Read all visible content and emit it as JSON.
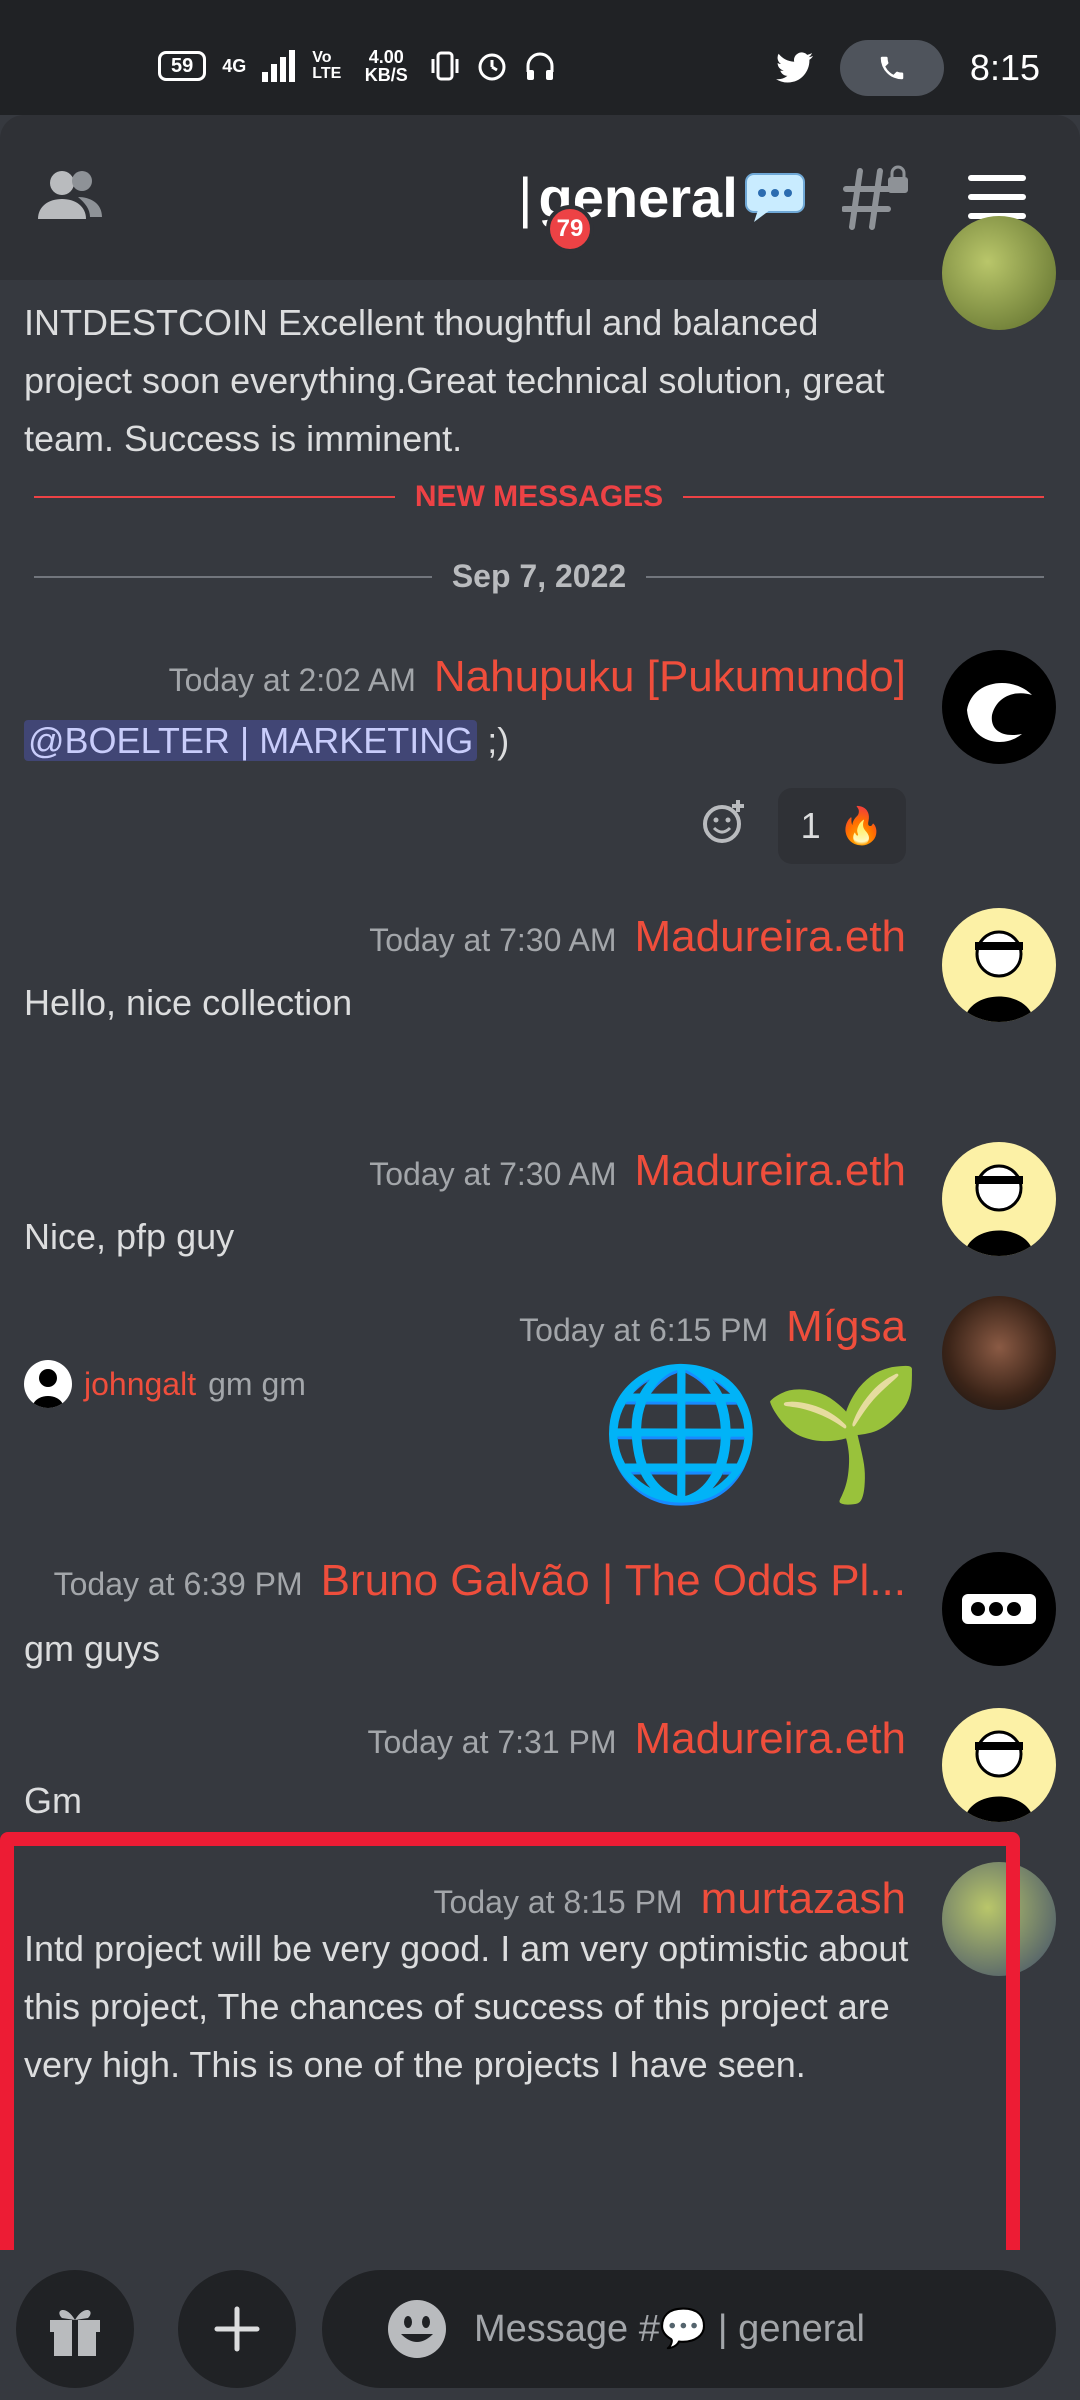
{
  "statusbar": {
    "battery": "59",
    "network": "4G",
    "volte": "Vo LTE",
    "speed": "4.00 KB/S",
    "time": "8:15"
  },
  "header": {
    "channel_name": "general",
    "unread_count": "79"
  },
  "old_message": {
    "text": "INTDESTCOIN Excellent thoughtful and balanced project soon everything.Great technical solution, great team. Success is imminent."
  },
  "dividers": {
    "new_messages": "NEW MESSAGES",
    "date": "Sep 7, 2022"
  },
  "messages": [
    {
      "timestamp": "Today at 2:02 AM",
      "author": "Nahupuku [Pukumundo]",
      "mention": "@BOELTER | MARKETING",
      "text": " ;)"
    },
    {
      "timestamp": "Today at 7:30 AM",
      "author": "Madureira.eth",
      "text": "Hello, nice collection"
    },
    {
      "timestamp": "Today at 7:30 AM",
      "author": "Madureira.eth",
      "text": "Nice, pfp guy"
    },
    {
      "timestamp": "Today at 6:15 PM",
      "author": "Mígsa",
      "text": "🌐🌱"
    },
    {
      "timestamp": "Today at 6:39 PM",
      "author": "Bruno Galvão | The Odds Pl...",
      "text": "gm guys"
    },
    {
      "timestamp": "Today at 7:31 PM",
      "author": "Madureira.eth",
      "text": "Gm"
    },
    {
      "timestamp": "Today at 8:15 PM",
      "author": "murtazash",
      "text": "Intd project will be very good. I am very optimistic about this project, The chances of success of this project are very high. This is one of the projects I have seen."
    }
  ],
  "reaction": {
    "count": "1",
    "emoji": "🔥"
  },
  "reply": {
    "name": "johngalt",
    "text": "gm gm"
  },
  "composer": {
    "placeholder": "Message #💬 | general"
  },
  "colors": {
    "accent_red": "#ed4245",
    "author": "#ef4e3c",
    "background": "#36393f"
  }
}
